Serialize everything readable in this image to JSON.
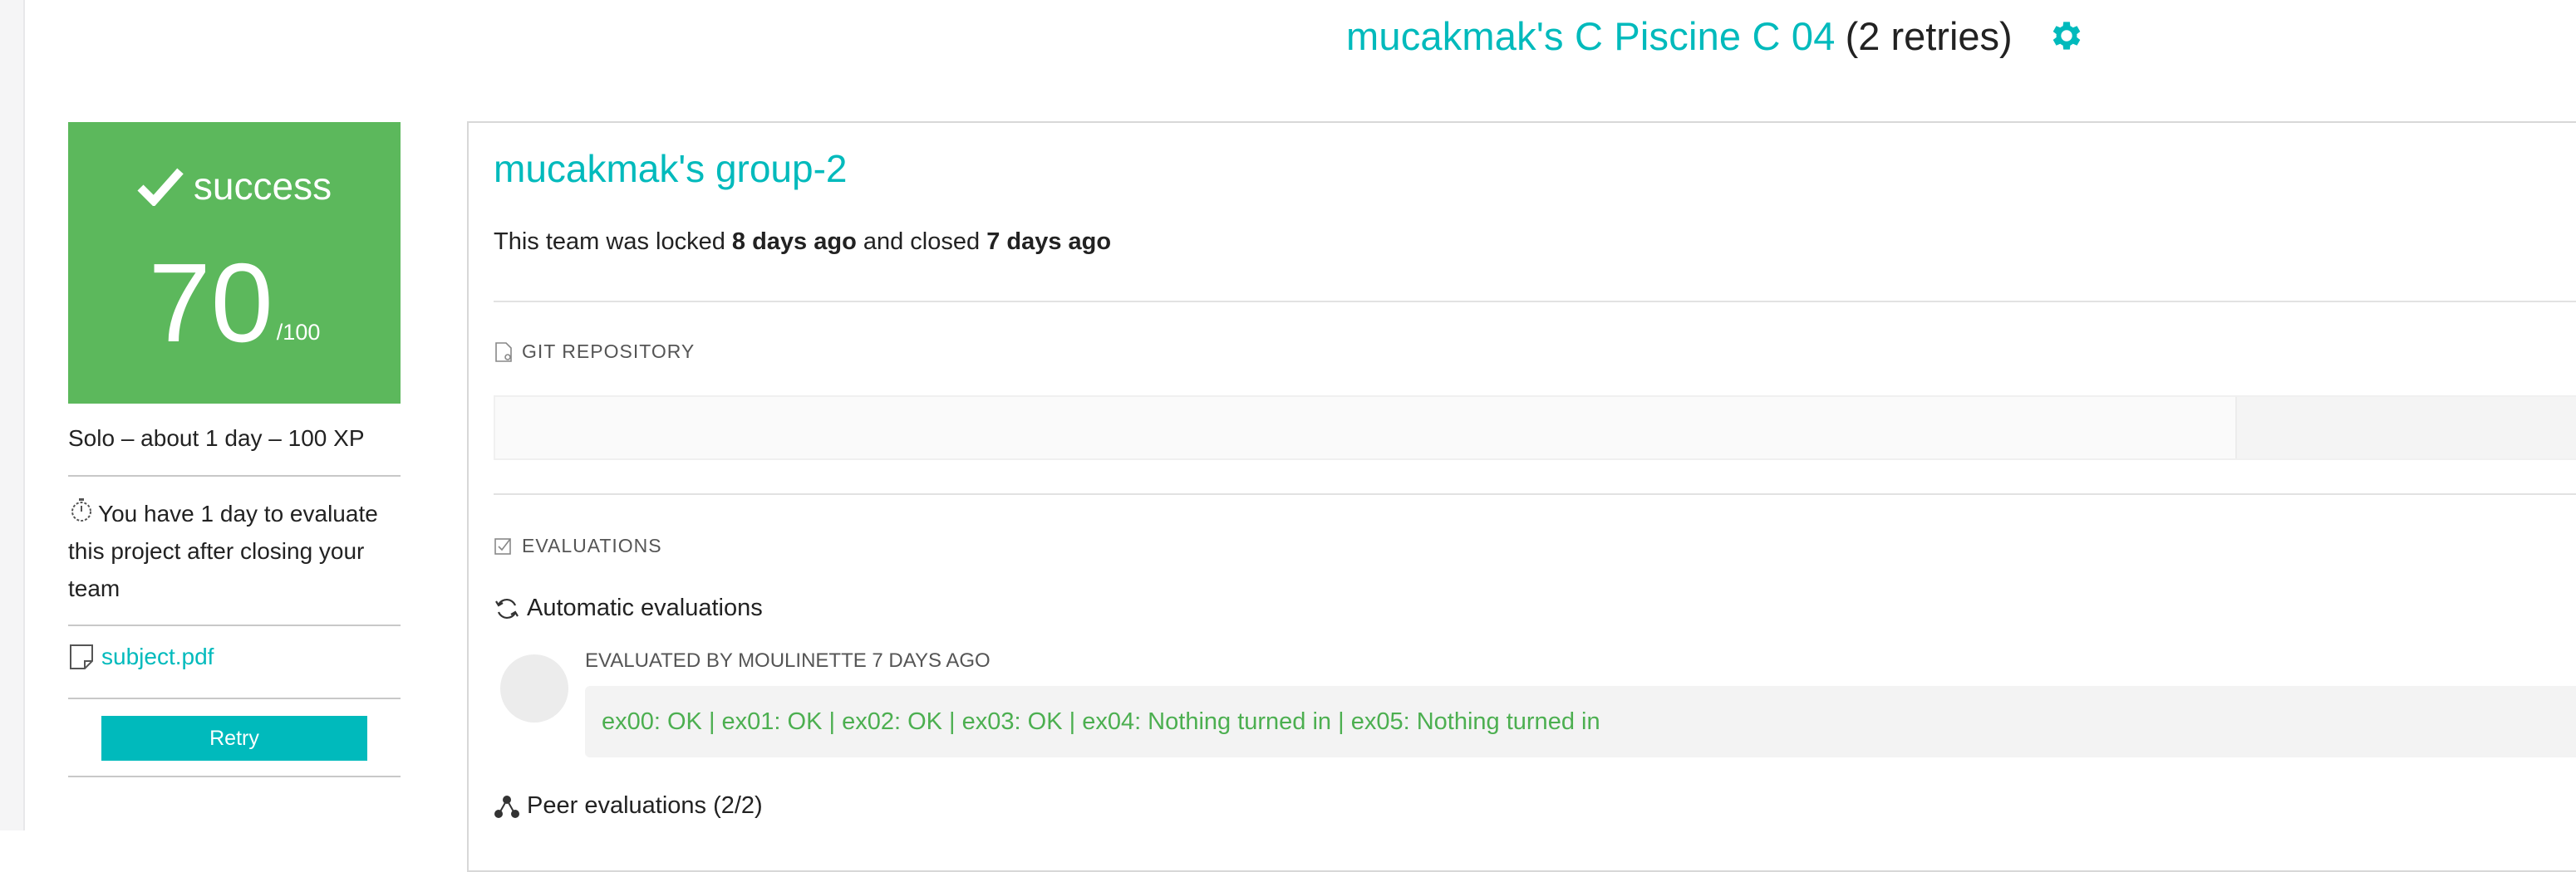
{
  "header": {
    "project_title": "mucakmak's C Piscine C 04",
    "retries": "(2 retries)",
    "settings_icon": "gear-icon",
    "accent_color": "#00babc"
  },
  "sidebar": {
    "status": "success",
    "status_color": "#5cb85c",
    "score": "70",
    "score_max": "/100",
    "meta": "Solo – about 1 day – 100 XP",
    "eval_note": "You have 1 day to evaluate this project after closing your team",
    "subject_link": "subject.pdf",
    "retry_label": "Retry"
  },
  "team": {
    "name": "mucakmak's group-2",
    "lock_prefix": "This team was locked ",
    "locked_ago": "8 days ago",
    "lock_middle": " and closed ",
    "closed_ago": "7 days ago"
  },
  "sections": {
    "git_repository": "GIT REPOSITORY",
    "evaluations": "EVALUATIONS"
  },
  "evaluations": {
    "automatic_title": "Automatic evaluations",
    "evaluated_by": "EVALUATED BY MOULINETTE 7 DAYS AGO",
    "result": "ex00: OK | ex01: OK | ex02: OK | ex03: OK | ex04: Nothing turned in | ex05: Nothing turned in",
    "result_color": "#4caf50",
    "peer_title": "Peer evaluations (2/2)"
  }
}
